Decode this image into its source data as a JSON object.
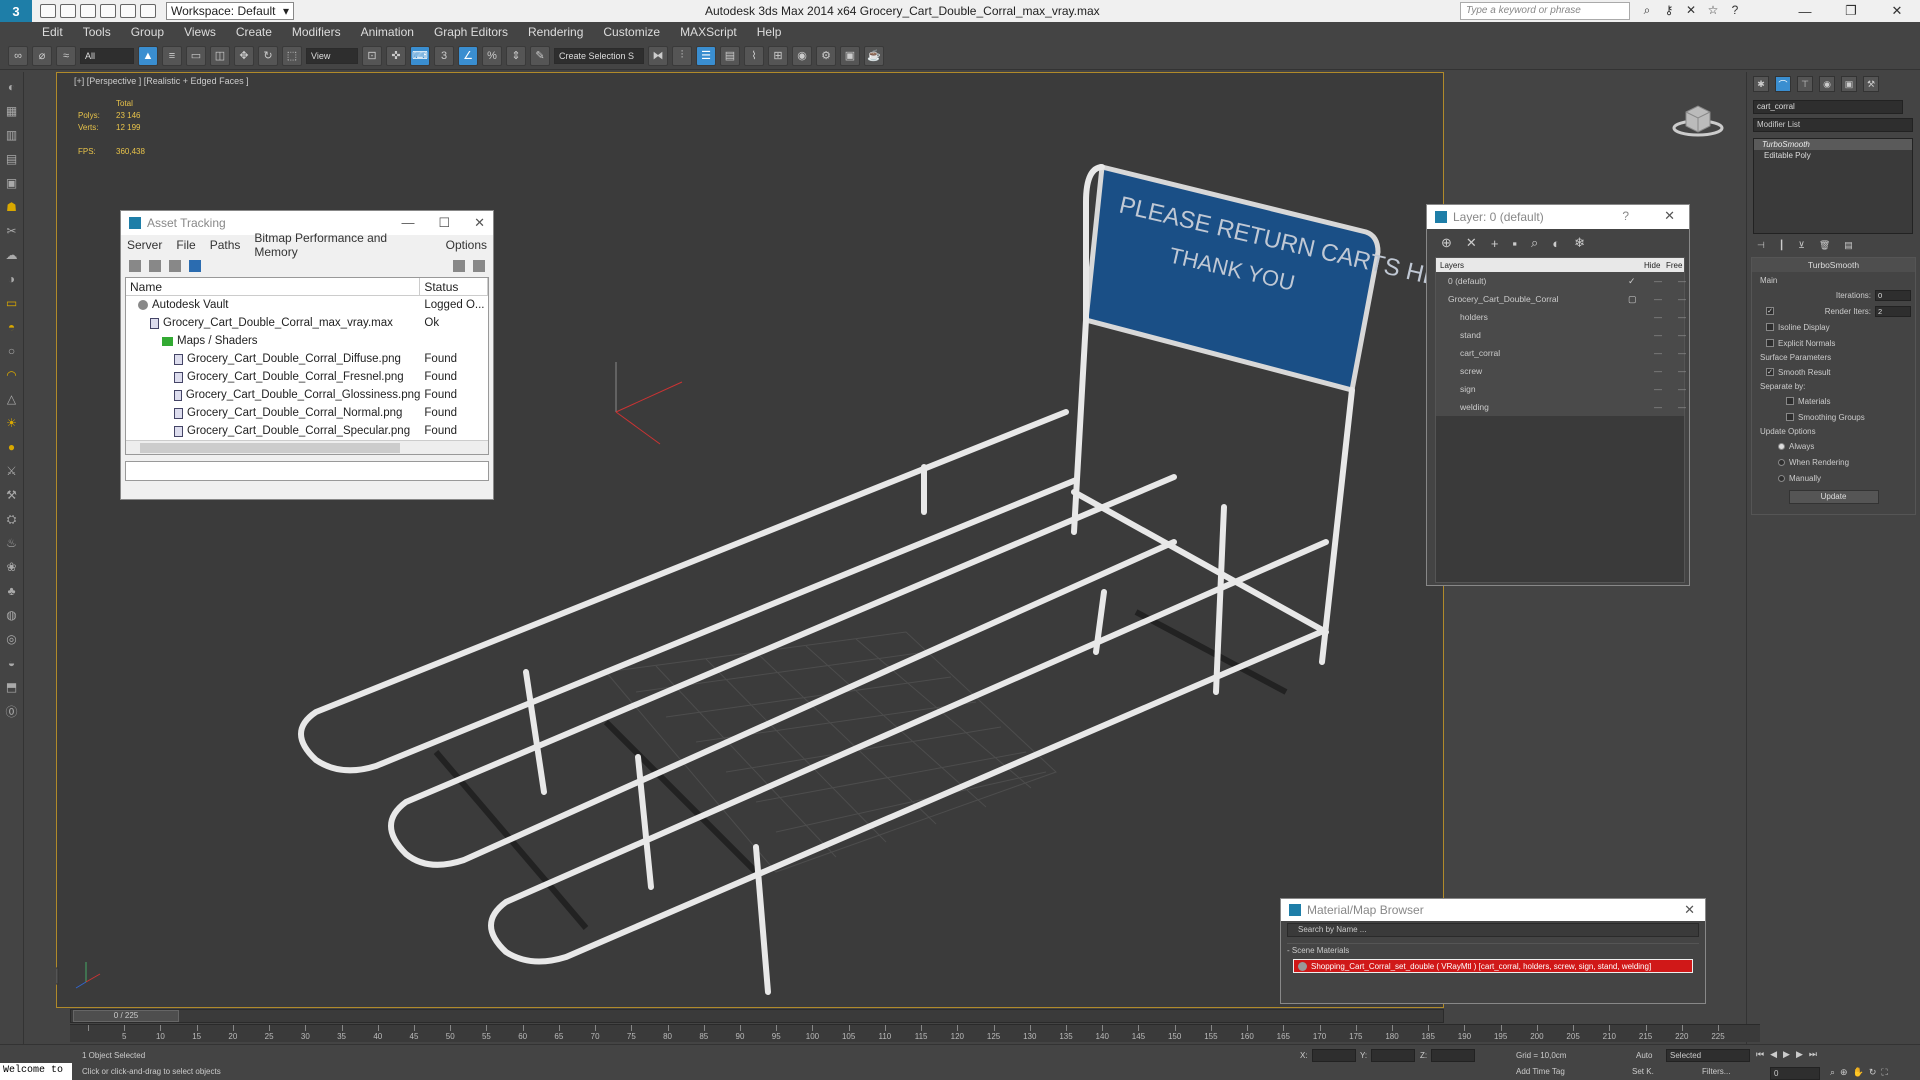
{
  "titlebar": {
    "workspace": "Workspace: Default",
    "title": "Autodesk 3ds Max  2014 x64     Grocery_Cart_Double_Corral_max_vray.max",
    "search_placeholder": "Type a keyword or phrase"
  },
  "menu": [
    "Edit",
    "Tools",
    "Group",
    "Views",
    "Create",
    "Modifiers",
    "Animation",
    "Graph Editors",
    "Rendering",
    "Customize",
    "MAXScript",
    "Help"
  ],
  "toolbar": {
    "filter": "All",
    "refcoord": "View",
    "selset": "Create Selection S"
  },
  "viewport": {
    "label": "[+] [Perspective ] [Realistic + Edged Faces ]",
    "stats": {
      "total_label": "Total",
      "polys_label": "Polys:",
      "polys": "23 146",
      "verts_label": "Verts:",
      "verts": "12 199",
      "fps_label": "FPS:",
      "fps": "360,438"
    },
    "sign_line1": "PLEASE RETURN CARTS HERE",
    "sign_line2": "THANK YOU"
  },
  "asset_tracking": {
    "title": "Asset Tracking",
    "menu": [
      "Server",
      "File",
      "Paths",
      "Bitmap Performance and Memory",
      "Options"
    ],
    "col_name": "Name",
    "col_status": "Status",
    "rows": [
      {
        "name": "Autodesk Vault",
        "status": "Logged O...",
        "indent": 1,
        "icon": "vault"
      },
      {
        "name": "Grocery_Cart_Double_Corral_max_vray.max",
        "status": "Ok",
        "indent": 2,
        "icon": "file"
      },
      {
        "name": "Maps / Shaders",
        "status": "",
        "indent": 3,
        "icon": "folder"
      },
      {
        "name": "Grocery_Cart_Double_Corral_Diffuse.png",
        "status": "Found",
        "indent": 4,
        "icon": "file"
      },
      {
        "name": "Grocery_Cart_Double_Corral_Fresnel.png",
        "status": "Found",
        "indent": 4,
        "icon": "file"
      },
      {
        "name": "Grocery_Cart_Double_Corral_Glossiness.png",
        "status": "Found",
        "indent": 4,
        "icon": "file"
      },
      {
        "name": "Grocery_Cart_Double_Corral_Normal.png",
        "status": "Found",
        "indent": 4,
        "icon": "file"
      },
      {
        "name": "Grocery_Cart_Double_Corral_Specular.png",
        "status": "Found",
        "indent": 4,
        "icon": "file"
      }
    ]
  },
  "layer_dialog": {
    "title": "Layer: 0 (default)",
    "help": "?",
    "col_layers": "Layers",
    "col_hide": "Hide",
    "col_freeze": "Free",
    "rows": [
      {
        "name": "0 (default)",
        "indent": 1,
        "mark": "✓"
      },
      {
        "name": "Grocery_Cart_Double_Corral",
        "indent": 1,
        "mark": "▢"
      },
      {
        "name": "holders",
        "indent": 2,
        "mark": ""
      },
      {
        "name": "stand",
        "indent": 2,
        "mark": ""
      },
      {
        "name": "cart_corral",
        "indent": 2,
        "mark": ""
      },
      {
        "name": "screw",
        "indent": 2,
        "mark": ""
      },
      {
        "name": "sign",
        "indent": 2,
        "mark": ""
      },
      {
        "name": "welding",
        "indent": 2,
        "mark": ""
      }
    ]
  },
  "command_panel": {
    "object_name": "cart_corral",
    "modifier_list": "Modifier List",
    "stack": [
      "TurboSmooth",
      "Editable Poly"
    ],
    "turbosmooth_title": "TurboSmooth",
    "main_label": "Main",
    "iterations_label": "Iterations:",
    "iterations": "0",
    "render_iters_label": "Render Iters:",
    "render_iters": "2",
    "isoline": "Isoline Display",
    "explicit_normals": "Explicit Normals",
    "surface_params": "Surface Parameters",
    "smooth_result": "Smooth Result",
    "separate_by": "Separate by:",
    "materials": "Materials",
    "smoothing_groups": "Smoothing Groups",
    "update_options": "Update Options",
    "always": "Always",
    "when_rendering": "When Rendering",
    "manually": "Manually",
    "update_btn": "Update"
  },
  "material_browser": {
    "title": "Material/Map Browser",
    "search_placeholder": "Search by Name ...",
    "group": "- Scene Materials",
    "item": "Shopping_Cart_Corral_set_double ( VRayMtl ) [cart_corral, holders, screw, sign, stand, welding]"
  },
  "timeline": {
    "slider_label": "0 / 225",
    "ticks": [
      0,
      5,
      10,
      15,
      20,
      25,
      30,
      35,
      40,
      45,
      50,
      55,
      60,
      65,
      70,
      75,
      80,
      85,
      90,
      95,
      100,
      105,
      110,
      115,
      120,
      125,
      130,
      135,
      140,
      145,
      150,
      155,
      160,
      165,
      170,
      175,
      180,
      185,
      190,
      195,
      200,
      205,
      210,
      215,
      220,
      225
    ],
    "max": 225
  },
  "status": {
    "maxscript": "Welcome to",
    "selection": "1 Object Selected",
    "prompt": "Click or click-and-drag to select objects",
    "x_label": "X:",
    "y_label": "Y:",
    "z_label": "Z:",
    "grid": "Grid = 10,0cm",
    "add_time_tag": "Add Time Tag",
    "auto": "Auto",
    "selected": "Selected",
    "set_k": "Set K.",
    "filters": "Filters...",
    "frame": "0"
  }
}
